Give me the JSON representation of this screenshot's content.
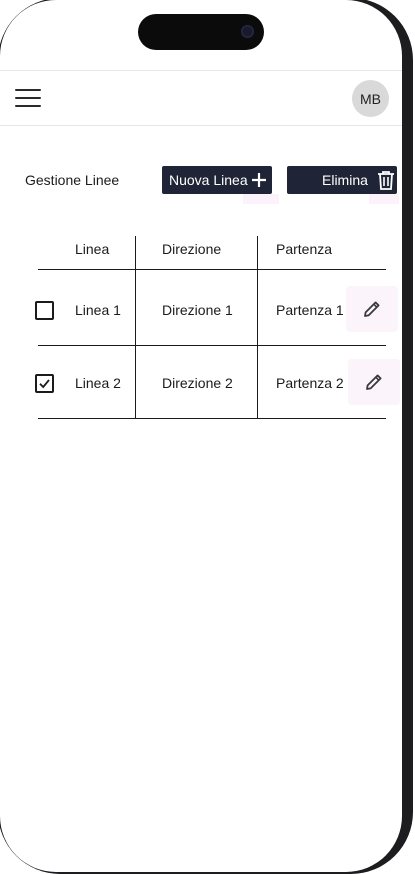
{
  "header": {
    "avatar_initials": "MB"
  },
  "toolbar": {
    "title": "Gestione Linee",
    "new_label": "Nuova Linea",
    "delete_label": "Elimina"
  },
  "table": {
    "columns": [
      "Linea",
      "Direzione",
      "Partenza"
    ],
    "rows": [
      {
        "linea": "Linea 1",
        "direzione": "Direzione 1",
        "partenza": "Partenza 1",
        "checked": false
      },
      {
        "linea": "Linea 2",
        "direzione": "Direzione 2",
        "partenza": "Partenza 2",
        "checked": true
      }
    ]
  },
  "icons": {
    "menu": "hamburger-icon",
    "new": "plus-icon",
    "delete": "trash-icon",
    "edit": "pencil-icon",
    "check": "check-icon"
  },
  "colors": {
    "button_bg": "#1f2537",
    "button_text": "#ffffff",
    "avatar_bg": "#d9d9d9",
    "edit_bg": "#fbf4fb"
  }
}
